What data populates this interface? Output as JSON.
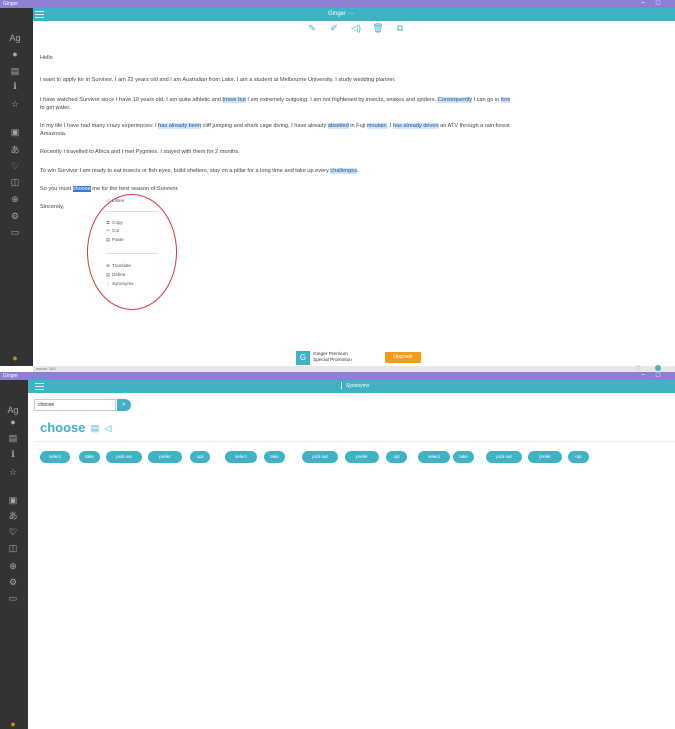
{
  "screen1": {
    "window": {
      "title": "Ginger",
      "minimize": "−",
      "maximize": "□"
    },
    "brand": "Ginger ···",
    "toolbar": [
      {
        "name": "edit-icon",
        "glyph": "✎"
      },
      {
        "name": "pen-icon",
        "glyph": "✐"
      },
      {
        "name": "speaker-icon",
        "glyph": "◁)"
      },
      {
        "name": "trash-icon",
        "glyph": "🗑"
      },
      {
        "name": "copy-icon",
        "glyph": "⧉"
      }
    ],
    "sidebar": [
      {
        "name": "grammar-icon",
        "glyph": "Ag"
      },
      {
        "name": "circle-icon",
        "glyph": "●"
      },
      {
        "name": "document-icon",
        "glyph": "▤"
      },
      {
        "name": "info-icon",
        "glyph": "ℹ"
      },
      {
        "name": "star-icon",
        "glyph": "☆"
      },
      {
        "name": "book-icon",
        "glyph": "▣"
      },
      {
        "name": "translate-icon",
        "glyph": "あ"
      },
      {
        "name": "heart-icon",
        "glyph": "♡"
      },
      {
        "name": "reader-icon",
        "glyph": "◫"
      },
      {
        "name": "add-icon",
        "glyph": "⊕"
      },
      {
        "name": "settings-icon",
        "glyph": "⚙"
      },
      {
        "name": "chat-icon",
        "glyph": "▭"
      },
      {
        "name": "premium-icon",
        "glyph": "●"
      }
    ],
    "document": {
      "lines": [
        [
          {
            "t": "Hello"
          }
        ],
        [
          {
            "t": "I want to apply for in Survivor. I am 22 years old and I am Australian from Lalor. I am a student at Melbourne University. I study wedding planner."
          }
        ],
        [
          {
            "t": "I have watched Survivor since I have 10 years old. I am quite athletic and "
          },
          {
            "t": "brave but",
            "h": "hl"
          },
          {
            "t": " I am extremely outgoing. I am not frightened by insects, snakes and spiders. "
          },
          {
            "t": "Consequently",
            "h": "hl"
          },
          {
            "t": " I can go in "
          },
          {
            "t": "fore",
            "h": "hl"
          }
        ],
        [
          {
            "t": "to get water."
          }
        ],
        [
          {
            "t": "In my life I have had many crazy experiences: I "
          },
          {
            "t": "has already been",
            "h": "hl"
          },
          {
            "t": " cliff jumping and shark cage diving. I have already "
          },
          {
            "t": "abseiled",
            "h": "hl"
          },
          {
            "t": " in Fuji "
          },
          {
            "t": "moutain",
            "h": "hl"
          },
          {
            "t": ". I "
          },
          {
            "t": "has already driven",
            "h": "hl"
          },
          {
            "t": " an ATV through a rain forest"
          }
        ],
        [
          {
            "t": "Amazonia."
          }
        ],
        [
          {
            "t": "Recently I travelled to Africa and I met Pygmies. I stayed with them for 2 months."
          }
        ],
        [
          {
            "t": "To win Survivor I am ready to eat insects or fish eyes, build shelters, stay on a pillar for a long time and take up every "
          },
          {
            "t": "challenges",
            "h": "hl"
          },
          {
            "t": "."
          }
        ],
        [
          {
            "t": "So you must "
          },
          {
            "t": "choose",
            "h": "sel"
          },
          {
            "t": " me for the best season of Survivor."
          }
        ],
        [
          {
            "t": "Sincerely,"
          }
        ]
      ]
    },
    "context_menu": [
      {
        "icon": "speaker-icon",
        "glyph": "◁",
        "label": "Listen"
      },
      {
        "icon": "copy-icon",
        "glyph": "⧉",
        "label": "Copy"
      },
      {
        "icon": "cut-icon",
        "glyph": "✂",
        "label": "Cut"
      },
      {
        "icon": "paste-icon",
        "glyph": "▤",
        "label": "Paste"
      },
      {
        "icon": "translate-icon",
        "glyph": "⊕",
        "label": "Translate"
      },
      {
        "icon": "define-icon",
        "glyph": "▤",
        "label": "Define"
      },
      {
        "icon": "synonyms-icon",
        "glyph": "⁝",
        "label": "Synonyms"
      }
    ],
    "premium": {
      "line1": "Ginger Premium",
      "line2": "Special Promotion",
      "upgrade": "Upgrade"
    },
    "status": "words: 183",
    "colors": {
      "accent": "#3fb3c4",
      "titlebar": "#8c7fd6",
      "selection": "#3a7bd5",
      "circle": "#d9363e",
      "upgrade": "#f39b1a"
    }
  },
  "screen2": {
    "window": {
      "title": "Ginger",
      "minimize": "−",
      "maximize": "□"
    },
    "panel_title": "Synonyms",
    "search": {
      "value": "choose",
      "button_glyph": "⌕"
    },
    "word": "choose",
    "word_icons": [
      {
        "name": "document-icon",
        "glyph": "▤"
      },
      {
        "name": "speaker-icon",
        "glyph": "◁"
      }
    ],
    "synonyms": [
      "select",
      "take",
      "pick out",
      "prefer",
      "opt",
      "select",
      "take",
      "pick out",
      "prefer",
      "opt",
      "select",
      "take",
      "pick out",
      "prefer",
      "opt"
    ],
    "sidebar": [
      {
        "name": "grammar-icon",
        "glyph": "Ag"
      },
      {
        "name": "circle-icon",
        "glyph": "●"
      },
      {
        "name": "document-icon",
        "glyph": "▤"
      },
      {
        "name": "info-icon",
        "glyph": "ℹ"
      },
      {
        "name": "star-icon",
        "glyph": "☆"
      },
      {
        "name": "book-icon",
        "glyph": "▣"
      },
      {
        "name": "translate-icon",
        "glyph": "あ"
      },
      {
        "name": "heart-icon",
        "glyph": "♡"
      },
      {
        "name": "reader-icon",
        "glyph": "◫"
      },
      {
        "name": "add-icon",
        "glyph": "⊕"
      },
      {
        "name": "settings-icon",
        "glyph": "⚙"
      },
      {
        "name": "chat-icon",
        "glyph": "▭"
      },
      {
        "name": "premium-icon",
        "glyph": "●"
      }
    ]
  }
}
